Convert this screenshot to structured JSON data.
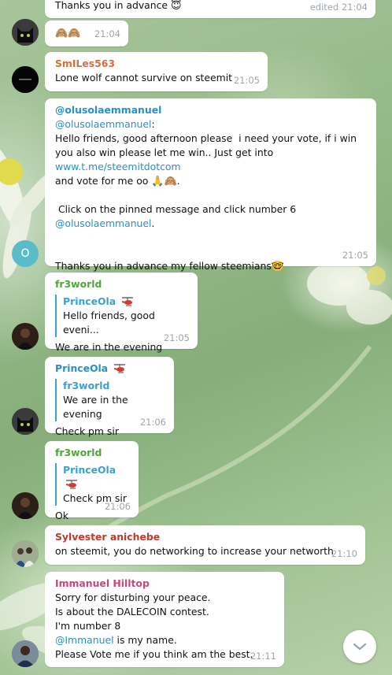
{
  "colors": {
    "link": "#2a8ec7",
    "reply_bar": "#37a1d8",
    "time": "#9ea5ab",
    "name_orange": "#d0703a",
    "name_blue": "#2a8ec7",
    "name_green": "#4fa53a",
    "name_red": "#c0392b",
    "name_pink": "#c24a7a"
  },
  "messages": [
    {
      "text": "Thanks you in advance",
      "emoji": "😇",
      "time": "edited 21:04"
    },
    {
      "emoji_text": "🙈🙈",
      "time": "21:04",
      "avatar_icon": "black-cat-icon"
    },
    {
      "sender": "SmILes563",
      "text": "Lone wolf cannot survive on steemit",
      "time": "21:05",
      "avatar_icon": "dark-logo-icon"
    },
    {
      "sender": "@olusolaemmanuel",
      "mention": "@olusolaemmanuel",
      "text_a": "Hello friends, good afternoon please  i need your vote, if i win you also win please let me win.. Just get into ",
      "link": "www.t.me/steemitdotcom",
      "text_b": "and vote for me oo ",
      "emoji_b": "🙏🙈",
      "text_c": " Click on the pinned message and click number 6",
      "mention2": "@olusolaemmanuel",
      "text_d": "Thanks you in advance my fellow steemians",
      "emoji_d": "🤓",
      "time": "21:05",
      "avatar_letter": "O",
      "avatar_color": "#5bbcc9"
    },
    {
      "sender": "fr3world",
      "reply_name": "PrinceOla",
      "reply_text": "Hello friends, good eveni...",
      "text": "We are in the evening",
      "time": "21:05",
      "avatar_icon": "portrait-photo-icon"
    },
    {
      "sender": "PrinceOla",
      "reply_name": "fr3world",
      "reply_text": "We are in the evening",
      "text": "Check pm sir",
      "time": "21:06",
      "avatar_icon": "black-cat-icon"
    },
    {
      "sender": "fr3world",
      "reply_name": "PrinceOla",
      "reply_text": "Check pm sir",
      "text": "Ok",
      "time": "21:06",
      "avatar_icon": "portrait-photo-icon"
    },
    {
      "sender": "Sylvester anichebe",
      "text": "on steemit, you do networking to increase your networth",
      "time": "21:10",
      "avatar_icon": "group-photo-icon"
    },
    {
      "sender": "Immanuel Hilltop",
      "line1": "Sorry for disturbing your peace.",
      "line2": "Is about the DALECOIN contest.",
      "line3": "I'm number 8",
      "mention": "@Immanuel",
      "line4_rest": " is my name.",
      "line5": "Please Vote me if you think am the best.",
      "time": "21:11",
      "avatar_icon": "person-photo-icon"
    }
  ],
  "scroll_button": {
    "icon": "chevron-down-icon"
  }
}
